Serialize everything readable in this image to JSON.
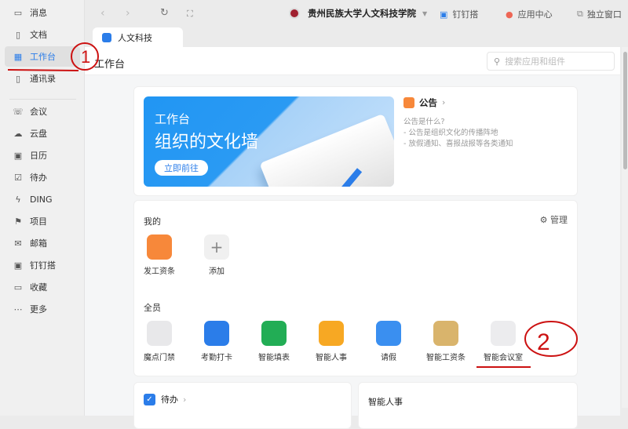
{
  "sidebar": {
    "items": [
      {
        "label": "消息",
        "icon": "message-icon"
      },
      {
        "label": "文档",
        "icon": "document-icon"
      },
      {
        "label": "工作台",
        "icon": "grid-icon",
        "active": true
      },
      {
        "label": "通讯录",
        "icon": "contacts-icon"
      },
      {
        "label": "会议",
        "icon": "meeting-icon"
      },
      {
        "label": "云盘",
        "icon": "cloud-icon"
      },
      {
        "label": "日历",
        "icon": "calendar-icon"
      },
      {
        "label": "待办",
        "icon": "todo-icon"
      },
      {
        "label": "DING",
        "icon": "lightning-icon"
      },
      {
        "label": "项目",
        "icon": "project-icon"
      },
      {
        "label": "邮箱",
        "icon": "mail-icon"
      },
      {
        "label": "钉钉搭",
        "icon": "builder-icon"
      },
      {
        "label": "收藏",
        "icon": "favorite-icon"
      },
      {
        "label": "更多",
        "icon": "more-icon"
      }
    ]
  },
  "topbar": {
    "org": "贵州民族大学人文科技学院",
    "links": [
      "钉钉搭",
      "应用中心",
      "独立窗口"
    ]
  },
  "tab": {
    "label": "人文科技"
  },
  "header": {
    "title": "工作台",
    "search_placeholder": "搜索应用和组件"
  },
  "banner": {
    "line1": "工作台",
    "line2": "组织的文化墙",
    "button": "立即前往"
  },
  "notice": {
    "title": "公告",
    "lines": [
      "公告是什么?",
      "- 公告是组织文化的传播阵地",
      "- 放假通知、喜报战报等各类通知"
    ]
  },
  "mine": {
    "title": "我的",
    "manage": "管理",
    "apps": [
      {
        "label": "发工资条",
        "color": "#f7883a"
      },
      {
        "label": "添加",
        "color": "#f0f0f0"
      }
    ]
  },
  "all": {
    "title": "全员",
    "apps": [
      {
        "label": "魔点门禁",
        "color": "#e8e8ea"
      },
      {
        "label": "考勤打卡",
        "color": "#2b7de9"
      },
      {
        "label": "智能填表",
        "color": "#22ad55"
      },
      {
        "label": "智能人事",
        "color": "#f7a823"
      },
      {
        "label": "请假",
        "color": "#3a8ff0"
      },
      {
        "label": "智能工资条",
        "color": "#d9b46c"
      },
      {
        "label": "智能会议室",
        "color": "#ececee"
      }
    ]
  },
  "bottom": {
    "todo": "待办",
    "hr": "智能人事"
  },
  "annotations": {
    "one": "1",
    "two": "2",
    "color": "#cc1111"
  }
}
